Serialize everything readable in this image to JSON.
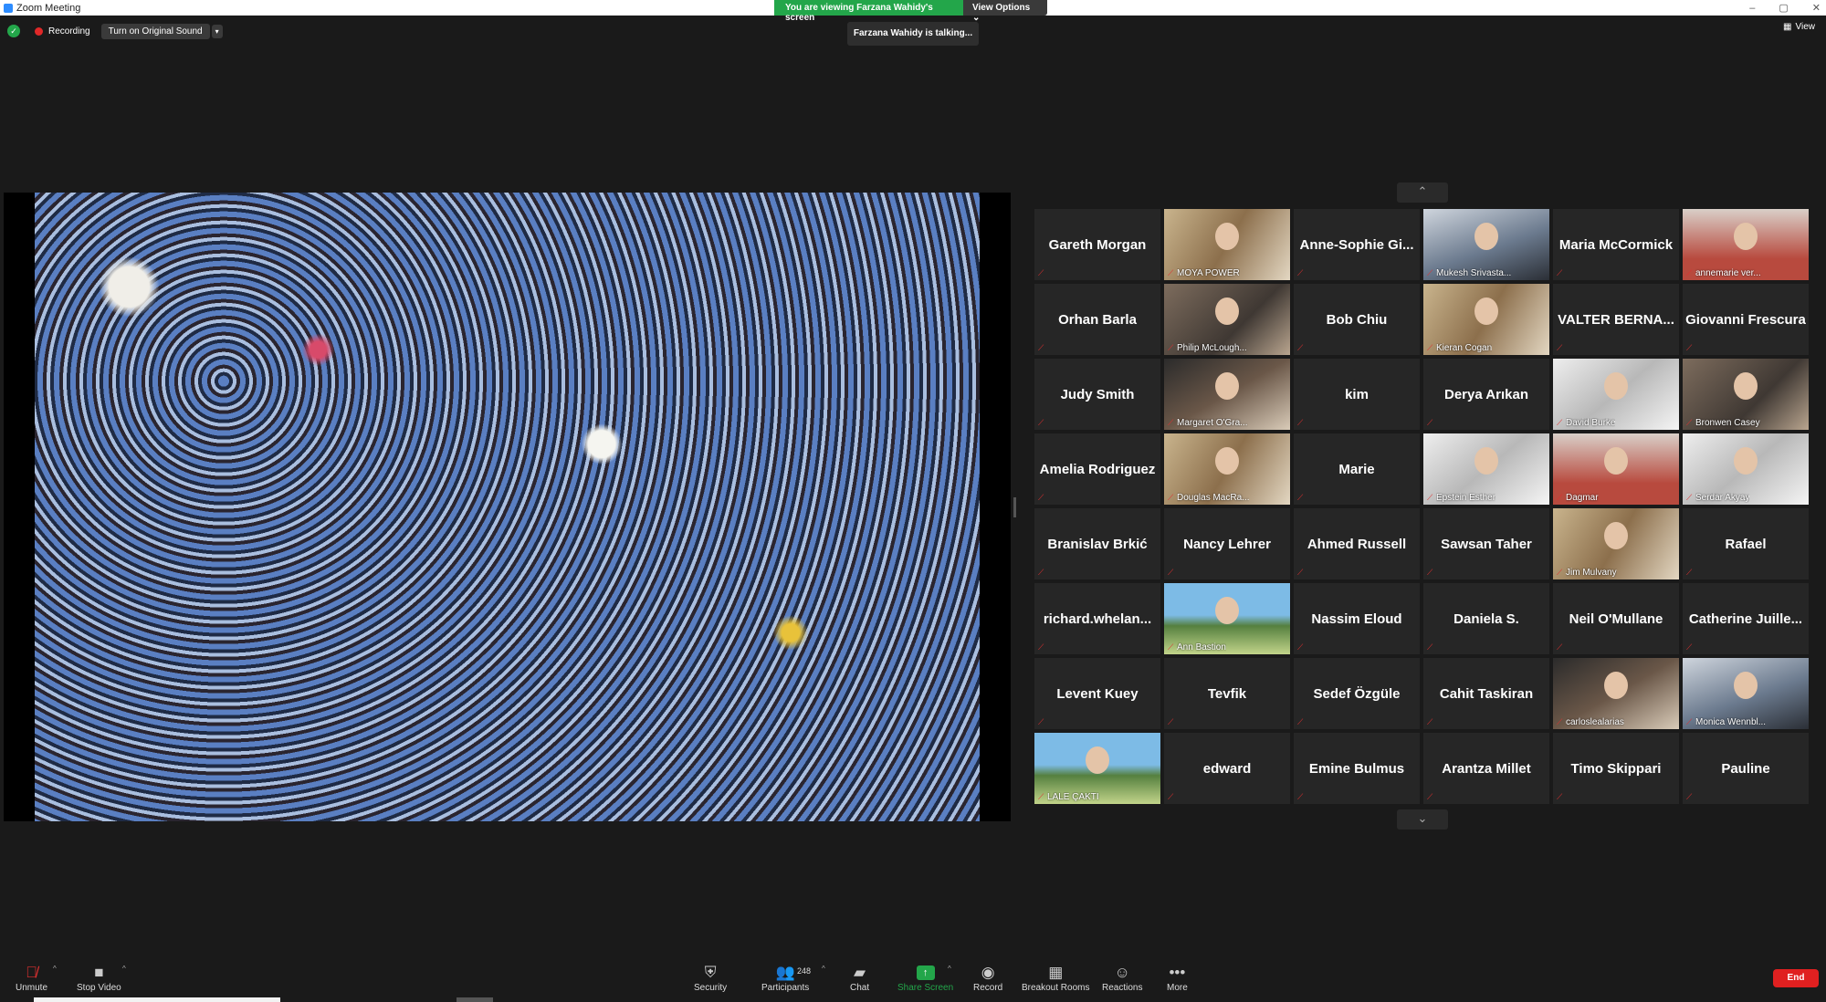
{
  "window": {
    "title": "Zoom Meeting",
    "controls": [
      "–",
      "▢",
      "✕"
    ]
  },
  "banner": {
    "viewing": "You are viewing Farzana Wahidy's screen",
    "view_options": "View Options ⌄"
  },
  "talking": "Farzana Wahidy is talking...",
  "recording": {
    "label": "Recording",
    "sound_button": "Turn on Original Sound",
    "caret": "▾"
  },
  "view_button": "View",
  "gallery": {
    "tiles": [
      {
        "name": "Gareth Morgan",
        "label": "",
        "video": false
      },
      {
        "name": "",
        "label": "MOYA POWER",
        "video": true,
        "style": "v3"
      },
      {
        "name": "Anne-Sophie  Gi...",
        "label": "",
        "video": false
      },
      {
        "name": "",
        "label": "Mukesh Srivasta...",
        "video": true,
        "style": "v2"
      },
      {
        "name": "Maria McCormick",
        "label": "",
        "video": false
      },
      {
        "name": "",
        "label": "annemarie ver...",
        "video": true,
        "style": "v7"
      },
      {
        "name": "Orhan Barla",
        "label": "",
        "video": false
      },
      {
        "name": "",
        "label": "Philip McLough...",
        "video": true,
        "style": "v1"
      },
      {
        "name": "Bob Chiu",
        "label": "",
        "video": false
      },
      {
        "name": "",
        "label": "Kieran Cogan",
        "video": true,
        "style": "v3"
      },
      {
        "name": "VALTER  BERNA...",
        "label": "",
        "video": false
      },
      {
        "name": "Giovanni Frescura",
        "label": "",
        "video": false
      },
      {
        "name": "Judy Smith",
        "label": "",
        "video": false
      },
      {
        "name": "",
        "label": "Margaret O'Gra...",
        "video": true,
        "style": "v6"
      },
      {
        "name": "kim",
        "label": "",
        "video": false
      },
      {
        "name": "Derya Arıkan",
        "label": "",
        "video": false
      },
      {
        "name": "",
        "label": "David Burke",
        "video": true,
        "style": "v5"
      },
      {
        "name": "",
        "label": "Bronwen Casey",
        "video": true,
        "style": "v1"
      },
      {
        "name": "Amelia Rodriguez",
        "label": "",
        "video": false
      },
      {
        "name": "",
        "label": "Douglas MacRa...",
        "video": true,
        "style": "v3"
      },
      {
        "name": "Marie",
        "label": "",
        "video": false
      },
      {
        "name": "",
        "label": "Epstein Esther",
        "video": true,
        "style": "v5"
      },
      {
        "name": "",
        "label": "Dagmar",
        "video": true,
        "style": "v7"
      },
      {
        "name": "",
        "label": "Serdar Akyay",
        "video": true,
        "style": "v5"
      },
      {
        "name": "Branislav Brkić",
        "label": "",
        "video": false
      },
      {
        "name": "Nancy Lehrer",
        "label": "",
        "video": false
      },
      {
        "name": "Ahmed Russell",
        "label": "",
        "video": false
      },
      {
        "name": "Sawsan Taher",
        "label": "",
        "video": false
      },
      {
        "name": "",
        "label": "Jim Mulvany",
        "video": true,
        "style": "v3"
      },
      {
        "name": "Rafael",
        "label": "",
        "video": false
      },
      {
        "name": "richard.whelan...",
        "label": "",
        "video": false
      },
      {
        "name": "",
        "label": "Ann Bastion",
        "video": true,
        "style": "v4"
      },
      {
        "name": "Nassim Eloud",
        "label": "",
        "video": false
      },
      {
        "name": "Daniela S.",
        "label": "",
        "video": false
      },
      {
        "name": "Neil O'Mullane",
        "label": "",
        "video": false
      },
      {
        "name": "Catherine  Juille...",
        "label": "",
        "video": false
      },
      {
        "name": "Levent Kuey",
        "label": "",
        "video": false
      },
      {
        "name": "Tevfik",
        "label": "",
        "video": false
      },
      {
        "name": "Sedef Özgüle",
        "label": "",
        "video": false
      },
      {
        "name": "Cahit Taskiran",
        "label": "",
        "video": false
      },
      {
        "name": "",
        "label": "carloslealarias",
        "video": true,
        "style": "v6"
      },
      {
        "name": "",
        "label": "Monica Wennbl...",
        "video": true,
        "style": "v2"
      },
      {
        "name": "",
        "label": "LALE ÇAKTI",
        "video": true,
        "style": "v4"
      },
      {
        "name": "edward",
        "label": "",
        "video": false
      },
      {
        "name": "Emine Bulmus",
        "label": "",
        "video": false
      },
      {
        "name": "Arantza Millet",
        "label": "",
        "video": false
      },
      {
        "name": "Timo Skippari",
        "label": "",
        "video": false
      },
      {
        "name": "Pauline",
        "label": "",
        "video": false
      }
    ]
  },
  "toolbar": {
    "unmute": "Unmute",
    "stop_video": "Stop Video",
    "security": "Security",
    "participants": "Participants",
    "participants_count": "248",
    "chat": "Chat",
    "share_screen": "Share Screen",
    "record": "Record",
    "breakout": "Breakout Rooms",
    "reactions": "Reactions",
    "more": "More",
    "end": "End"
  },
  "colors": {
    "accent_green": "#23a64a",
    "end_red": "#e02020",
    "mic_muted": "#e03030"
  }
}
